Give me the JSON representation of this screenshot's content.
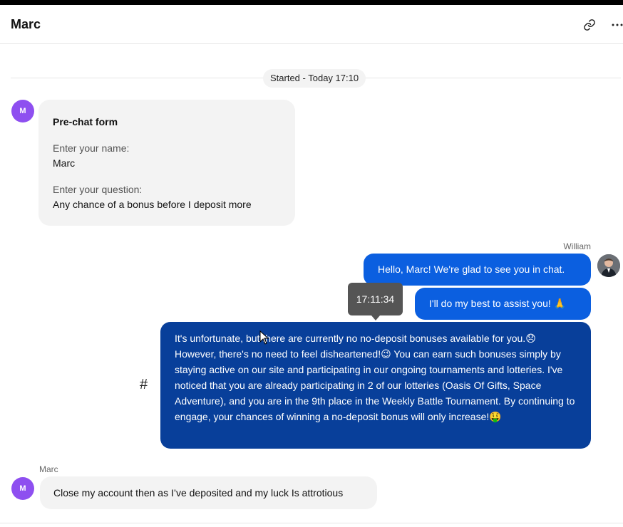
{
  "header": {
    "title": "Marc"
  },
  "timeline": {
    "started_label": "Started - Today 17:10"
  },
  "prechat": {
    "avatar_initial": "M",
    "title": "Pre-chat form",
    "name_label": "Enter your name:",
    "name_value": "Marc",
    "question_label": "Enter your question:",
    "question_value": "Any chance of a bonus before I deposit more"
  },
  "agent": {
    "name": "William",
    "messages": [
      "Hello, Marc! We're glad to see you in chat.",
      "I'll do my best to assist you! 🙏",
      "It's unfortunate, but there are currently no no-deposit bonuses available for you.😞 However, there's no need to feel disheartened!😉 You can earn such bonuses simply by staying active on our site and participating in our ongoing tournaments and lotteries. I've noticed that you are already participating in 2 of our lotteries (Oasis Of Gifts, Space Adventure), and you are in the 9th place in the Weekly Battle Tournament. By continuing to engage, your chances of winning a no-deposit bonus will only increase!🤑"
    ],
    "tooltip_time": "17:11:34",
    "hash_symbol": "#"
  },
  "customer": {
    "name": "Marc",
    "avatar_initial": "M",
    "message": "Close my account then as I’ve deposited and my luck Is attrotious"
  },
  "colors": {
    "avatar_purple": "#8e4ff0",
    "agent_bubble": "#0b5fe0",
    "agent_bubble_dark": "#083f9a",
    "customer_bubble": "#f3f3f3"
  }
}
